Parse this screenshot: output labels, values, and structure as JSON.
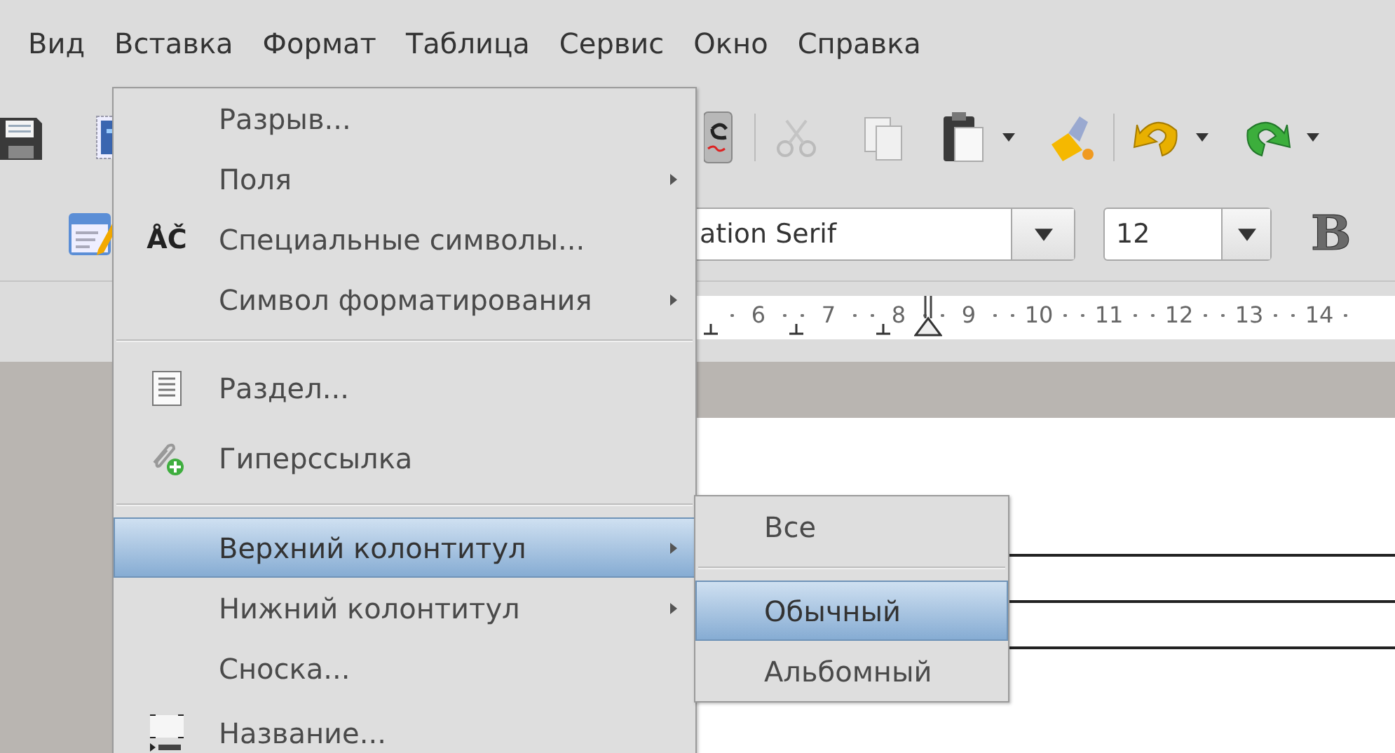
{
  "menubar": [
    "Вид",
    "Вставка",
    "Формат",
    "Таблица",
    "Сервис",
    "Окно",
    "Справка"
  ],
  "formatting": {
    "font_name": "ation Serif",
    "font_size": "12",
    "bold_label": "B"
  },
  "ruler": {
    "numbers": [
      "6",
      "7",
      "8",
      "9",
      "10",
      "11",
      "12",
      "13",
      "14"
    ]
  },
  "insert_menu": {
    "items": [
      {
        "kind": "item",
        "label": "Разрыв...",
        "submenu": false,
        "selected": false
      },
      {
        "kind": "item",
        "label": "Поля",
        "submenu": true,
        "selected": false
      },
      {
        "kind": "item",
        "label": "Специальные символы...",
        "icon_glyph": "ÅČ",
        "submenu": false,
        "selected": false
      },
      {
        "kind": "item",
        "label": "Символ форматирования",
        "submenu": true,
        "selected": false
      },
      {
        "kind": "separator"
      },
      {
        "kind": "item",
        "label": "Раздел...",
        "submenu": false,
        "selected": false
      },
      {
        "kind": "item",
        "label": "Гиперссылка",
        "submenu": false,
        "selected": false
      },
      {
        "kind": "separator"
      },
      {
        "kind": "item",
        "label": "Верхний колонтитул",
        "submenu": true,
        "selected": true
      },
      {
        "kind": "item",
        "label": "Нижний колонтитул",
        "submenu": true,
        "selected": false
      },
      {
        "kind": "item",
        "label": "Сноска...",
        "submenu": false,
        "selected": false
      },
      {
        "kind": "item",
        "label": "Название...",
        "submenu": false,
        "selected": false
      }
    ]
  },
  "header_submenu": {
    "items": [
      {
        "kind": "item",
        "label": "Все",
        "selected": false
      },
      {
        "kind": "separator"
      },
      {
        "kind": "item",
        "label": "Обычный",
        "selected": true
      },
      {
        "kind": "item",
        "label": "Альбомный",
        "selected": false
      }
    ]
  }
}
